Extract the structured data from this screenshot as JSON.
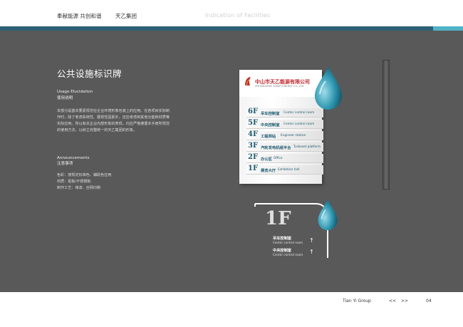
{
  "header": {
    "left_text": "奉献能源  共创和谐",
    "company": "天乙集团",
    "subtitle": "Indication of Facilities"
  },
  "colors": {
    "accent_dark": "#2b6074",
    "accent_light": "#4fb2c6",
    "background": "#595959",
    "logo_red": "#c2272d",
    "floor_text": "#1d5a70"
  },
  "content": {
    "title": "公共设施标识牌",
    "usage_en": "Usage Elucidation",
    "usage_cn": "使用说明",
    "usage_text": "本部分是基本要素规范在企业环境形象包装上的应用。在各项目实际制作时，除了考虑系统性、展现性因素外，还应考虑到其他功能和材质等实际应用。所以有关企业内部形象的表现，均应严格遵循本手册所规范的使用方法，以树立完整统一的天乙集团的形象。",
    "announce_en": "Announcements",
    "announce_cn": "注意事项",
    "notes": [
      "色彩：按规定标准色、辅助色应用",
      "材质：铝板/不锈钢板",
      "制作工艺：烤漆、丝网印刷"
    ]
  },
  "sign": {
    "company_cn": "中山市天乙能源有限公司",
    "company_en": "ZHONGSHAN TIANYI ENERGY CO.,LTD",
    "floors": [
      {
        "num": "6F",
        "cn": "吊车控制室",
        "en": "Center control room"
      },
      {
        "num": "5F",
        "cn": "中央控制室",
        "en": "Center control room"
      },
      {
        "num": "4F",
        "cn": "工程师站",
        "en": "Engineer station"
      },
      {
        "num": "3F",
        "cn": "汽轮发电机组平台",
        "en": "Turboset platform"
      },
      {
        "num": "2F",
        "cn": "办公区",
        "en": "Office"
      },
      {
        "num": "1F",
        "cn": "展览大厅",
        "en": "Exhibition hall"
      }
    ]
  },
  "small_sign": {
    "floor": "1F",
    "items": [
      {
        "cn": "吊车控制室",
        "en": "Center control room",
        "arrow": "↑"
      },
      {
        "cn": "中央控制室",
        "en": "Center control room",
        "arrow": "↑"
      }
    ]
  },
  "footer": {
    "group": "Tian Yi Group",
    "prev": "<<",
    "next": ">>",
    "page": "04"
  }
}
